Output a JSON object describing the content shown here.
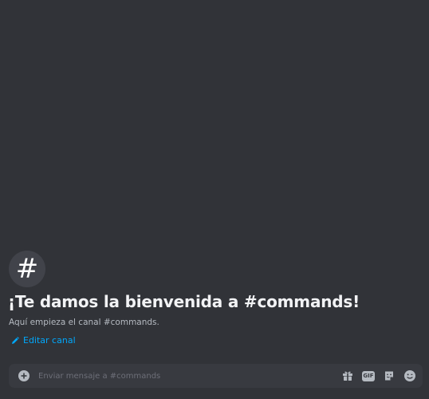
{
  "channel": {
    "icon_glyph": "#",
    "icon": "hashtag-icon"
  },
  "welcome": {
    "title": "¡Te damos la bienvenida a #commands!",
    "subtitle": "Aquí empieza el canal #commands."
  },
  "edit_channel": {
    "label": "Editar canal",
    "icon": "pencil-icon"
  },
  "composer": {
    "placeholder": "Enviar mensaje a #commands",
    "value": "",
    "upload_icon": "plus-circle-icon",
    "tools": [
      {
        "name": "gift-icon"
      },
      {
        "name": "gif-icon",
        "label": "GIF"
      },
      {
        "name": "sticker-icon"
      },
      {
        "name": "emoji-icon"
      }
    ]
  },
  "colors": {
    "background": "#313338",
    "composer_background": "#383a40",
    "link": "#00a8fc",
    "title": "#f2f3f5",
    "muted": "#b5bac1"
  }
}
